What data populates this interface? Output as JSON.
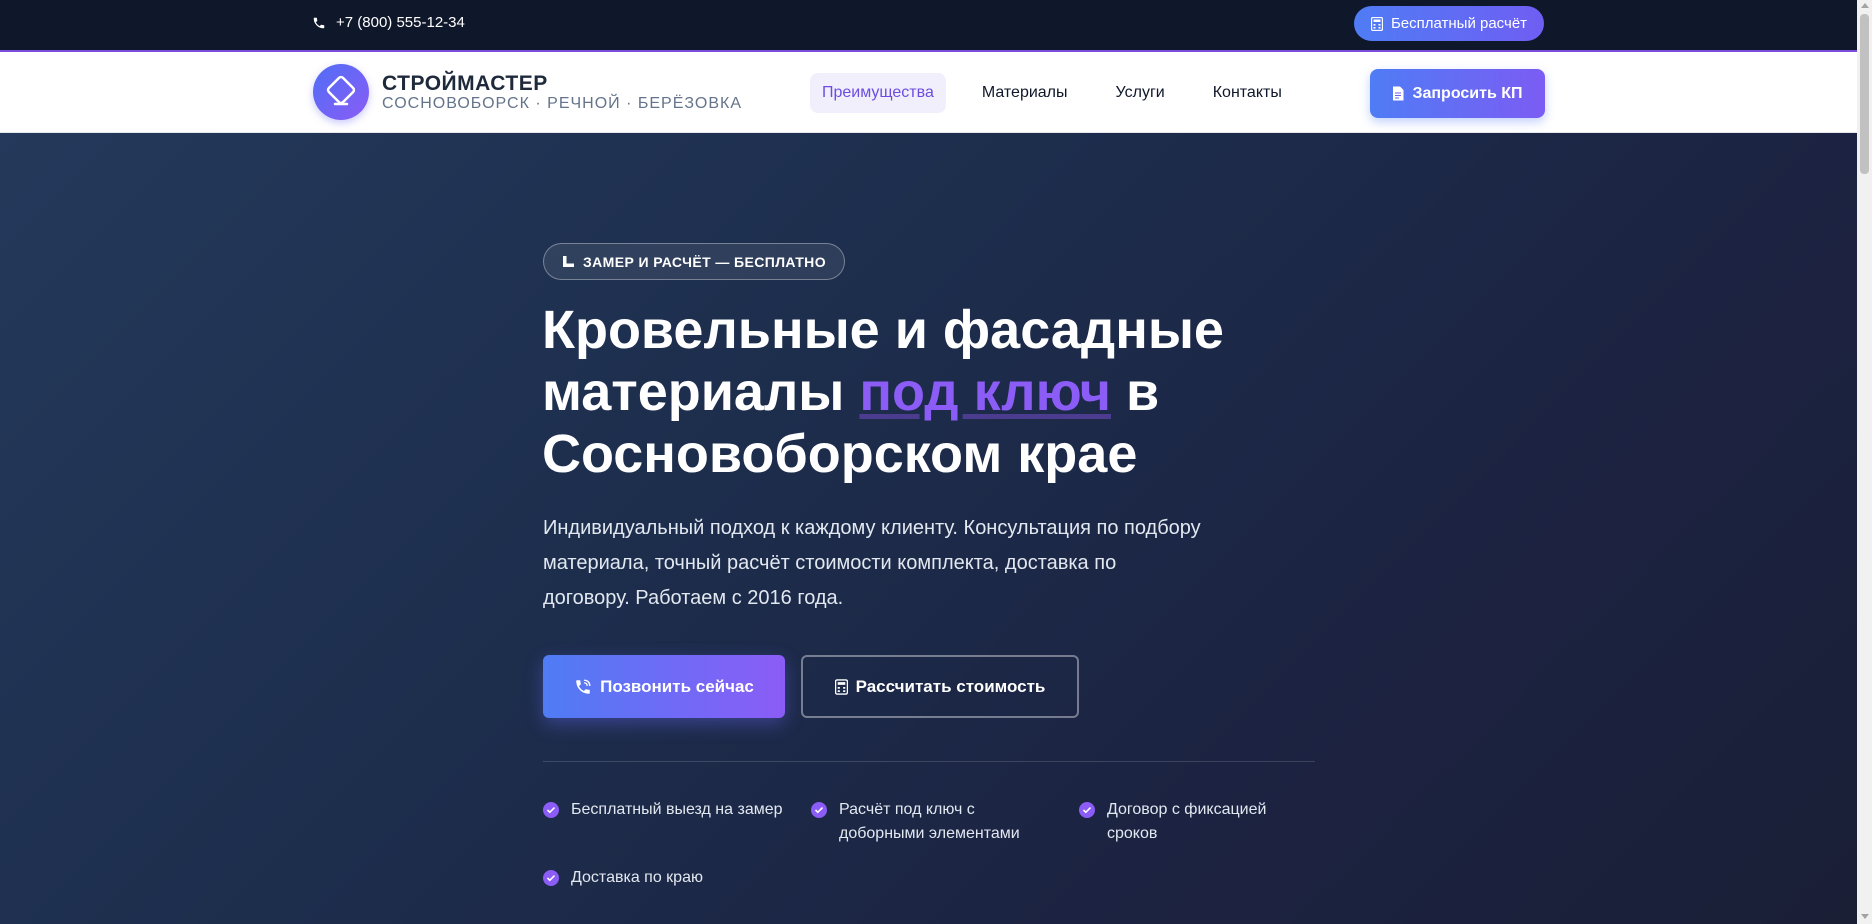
{
  "topbar": {
    "phone_icon": "phone-icon",
    "phone": "+7 (800) 555-12-34",
    "calc_icon": "calculator-icon",
    "calc_label": "Бесплатный расчёт"
  },
  "navbar": {
    "logo_icon": "diamond-logo-icon",
    "brand_name": "СТРОЙМАСТЕР",
    "brand_sub": "СОСНОВОБОРСК · РЕЧНОЙ · БЕРЁЗОВКА",
    "links": [
      {
        "label": "Преимущества",
        "active": true
      },
      {
        "label": "Материалы",
        "active": false
      },
      {
        "label": "Услуги",
        "active": false
      },
      {
        "label": "Контакты",
        "active": false
      }
    ],
    "kp_icon": "document-icon",
    "kp_label": "Запросить КП"
  },
  "hero": {
    "badge_icon": "ruler-icon",
    "badge": "ЗАМЕР И РАСЧЁТ — БЕСПЛАТНО",
    "title_part1": "Кровельные и фасадные материалы",
    "title_accent": "под ключ",
    "title_part2": "в Сосновоборском крае",
    "lead": "Индивидуальный подход к каждому клиенту. Консультация по подбору материала, точный расчёт стоимости комплекта, доставка по договору. Работаем с 2016 года.",
    "call_icon": "phone-volume-icon",
    "call_label": "Позвонить сейчас",
    "calc_icon": "calculator-icon",
    "calc_label": "Рассчитать стоимость",
    "features": [
      "Бесплатный выезд на замер",
      "Расчёт под ключ с доборными элементами",
      "Договор с фиксацией сроков",
      "Доставка по краю"
    ]
  },
  "colors": {
    "accent": "#8b5cf6",
    "primary": "#4f7cf5",
    "dark": "#0f172a"
  }
}
